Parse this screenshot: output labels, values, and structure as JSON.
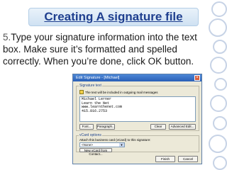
{
  "slide": {
    "title": "Creating A signature file",
    "step_number": "5.",
    "step_text": "Type your signature information into the text box. Make sure it’s formatted and spelled correctly. When you’re done, click OK button."
  },
  "dialog": {
    "title": "Edit Signature - [Michael]",
    "group_label": "Signature text",
    "note": "The text will be included in outgoing mail messages",
    "signature_lines": [
      "Michael Lerner",
      "Learn the Net",
      "www.learnthenet.com",
      "415.816.2753"
    ],
    "buttons": {
      "font": "Font...",
      "paragraph": "Paragraph...",
      "clear": "Clear",
      "advanced": "Advanced Edit..."
    },
    "vcard_group_label": "vCard options",
    "vcard_text": "Attach this business card (vCard) to this signature:",
    "vcard_select": "<None>",
    "new_vcard": "New vCard from Contact...",
    "finish": "Finish",
    "cancel": "Cancel"
  },
  "colors": {
    "title_text": "#1f3f8f",
    "accent_circles": "#c7d3e6"
  }
}
